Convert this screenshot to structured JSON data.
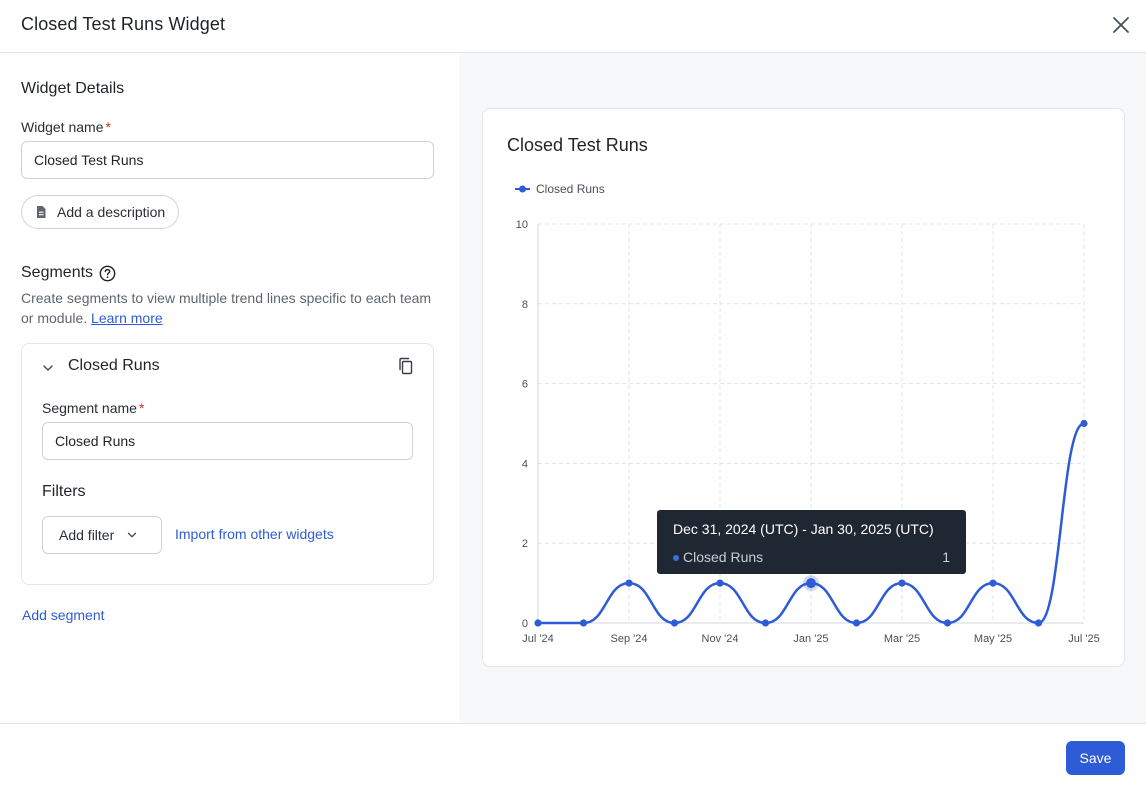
{
  "header": {
    "title": "Closed Test Runs Widget",
    "close_icon": "close-icon"
  },
  "details": {
    "section_title": "Widget Details",
    "widget_name_label": "Widget name",
    "required_mark": "*",
    "widget_name_value": "Closed Test Runs",
    "add_description_label": "Add a description",
    "add_description_icon": "document-icon"
  },
  "segments": {
    "title": "Segments",
    "help_icon": "help-circle-icon",
    "description": "Create segments to view multiple trend lines specific to each team or module.",
    "learn_more": "Learn more",
    "items": [
      {
        "name": "Closed Runs",
        "segment_name_label": "Segment name",
        "segment_name_value": "Closed Runs",
        "filters_title": "Filters",
        "add_filter_label": "Add filter",
        "import_label": "Import from other widgets"
      }
    ],
    "add_segment_label": "Add segment"
  },
  "preview": {
    "title": "Closed Test Runs",
    "legend_label": "Closed Runs",
    "tooltip": {
      "title": "Dec 31, 2024 (UTC) - Jan 30, 2025 (UTC)",
      "series": "Closed Runs",
      "value": "1"
    }
  },
  "chart_data": {
    "type": "line",
    "title": "Closed Test Runs",
    "xlabel": "",
    "ylabel": "",
    "ylim": [
      0,
      10
    ],
    "yticks": [
      "0",
      "2",
      "4",
      "6",
      "8",
      "10"
    ],
    "xticks": [
      "Jul '24",
      "Sep '24",
      "Nov '24",
      "Jan '25",
      "Mar '25",
      "May '25",
      "Jul '25"
    ],
    "grid": true,
    "legend": "top-left",
    "color": "#2e5bd6",
    "series": [
      {
        "name": "Closed Runs",
        "x": [
          "2024-07",
          "2024-08",
          "2024-09",
          "2024-10",
          "2024-11",
          "2024-12",
          "2025-01",
          "2025-02",
          "2025-03",
          "2025-04",
          "2025-05",
          "2025-06",
          "2025-07"
        ],
        "values": [
          0,
          0,
          1,
          0,
          1,
          0,
          1,
          0,
          1,
          0,
          1,
          0,
          5
        ]
      }
    ]
  },
  "footer": {
    "save_label": "Save"
  }
}
